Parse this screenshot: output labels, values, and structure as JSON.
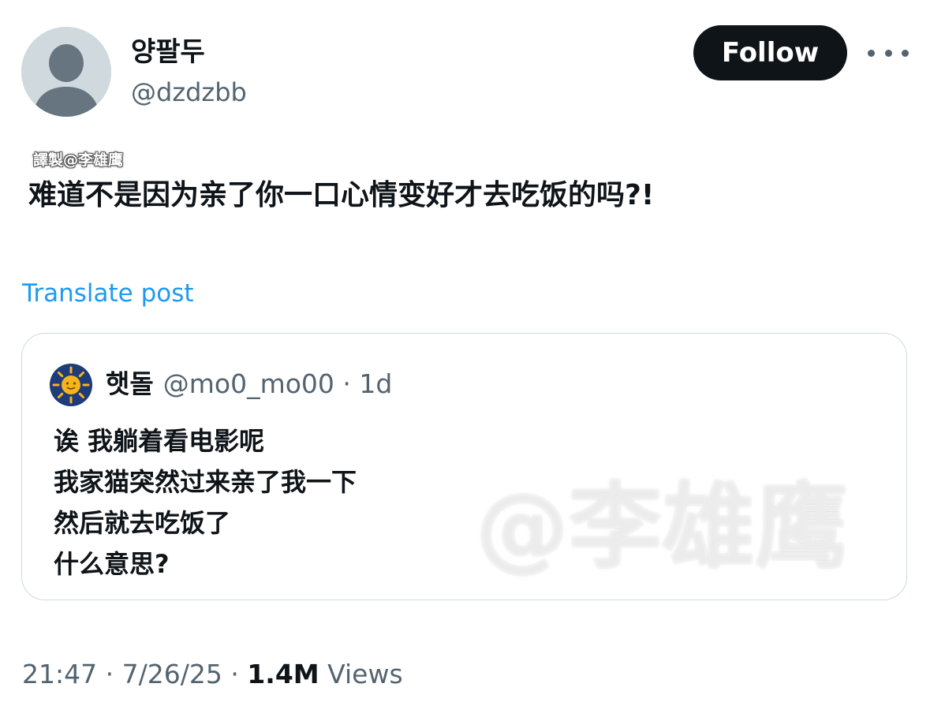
{
  "author": {
    "display_name": "양팔두",
    "handle": "@dzdzbb",
    "avatar_icon": "default-avatar-icon"
  },
  "actions": {
    "follow_label": "Follow",
    "more_icon": "more-dots-icon"
  },
  "post": {
    "credit_tag": "譯製@李雄鹰",
    "text": "难道不是因为亲了你一口心情变好才去吃饭的吗?!",
    "translate_label": "Translate post"
  },
  "quote": {
    "display_name": "햇돌",
    "handle": "@mo0_mo00",
    "separator": "·",
    "time": "1d",
    "avatar_icon": "sun-avatar-icon",
    "lines": [
      "诶 我躺着看电影呢",
      "我家猫突然过来亲了我一下",
      "然后就去吃饭了",
      "什么意思?"
    ],
    "watermark": "@李雄鹰"
  },
  "meta": {
    "time": "21:47",
    "separator": "·",
    "date": "7/26/25",
    "views_count": "1.4M",
    "views_label": "Views"
  },
  "colors": {
    "link": "#1d9bf0",
    "secondary_text": "#536471",
    "primary_text": "#0f1419",
    "follow_button_bg": "#0f1419",
    "card_border": "#cfd9de"
  }
}
